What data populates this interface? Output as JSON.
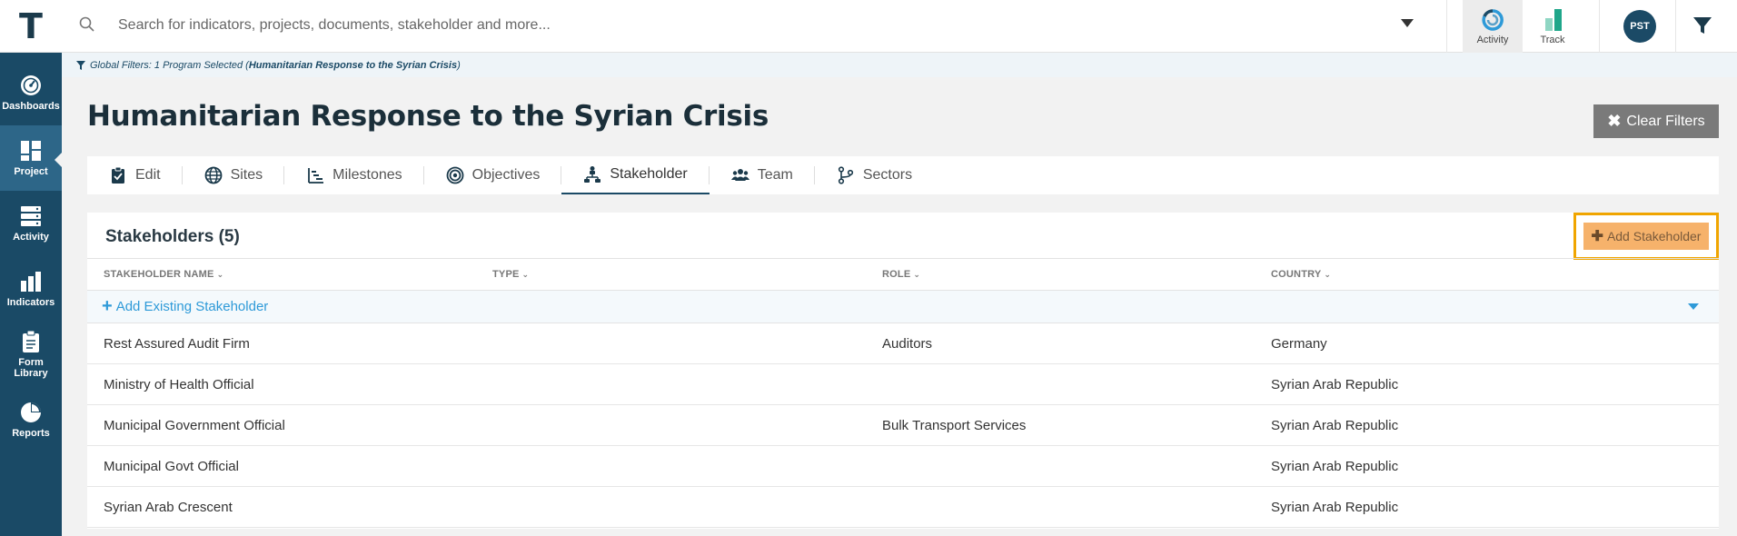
{
  "topbar": {
    "logo": "T",
    "search_placeholder": "Search for indicators, projects, documents, stakeholder and more...",
    "apps": [
      {
        "label": "Activity",
        "icon": "activity-app-icon",
        "active": true
      },
      {
        "label": "Track",
        "icon": "track-app-icon",
        "active": false
      }
    ],
    "avatar": "PST"
  },
  "sidebar": {
    "items": [
      {
        "label": "Dashboards",
        "icon": "dashboard-gauge-icon"
      },
      {
        "label": "Project",
        "icon": "project-grid-icon",
        "active": true
      },
      {
        "label": "Activity",
        "icon": "activity-list-icon"
      },
      {
        "label": "Indicators",
        "icon": "bar-chart-icon"
      },
      {
        "label_line1": "Form",
        "label_line2": "Library",
        "icon": "clipboard-icon"
      },
      {
        "label": "Reports",
        "icon": "pie-chart-icon"
      }
    ]
  },
  "global_filter": {
    "prefix": "Global Filters: 1 Program Selected ( ",
    "program": "Humanitarian Response to the Syrian Crisis",
    "suffix": " )"
  },
  "page": {
    "title": "Humanitarian Response to the Syrian Crisis",
    "clear_filters": "Clear Filters"
  },
  "tabs": [
    {
      "label": "Edit",
      "icon": "clipboard-check-icon"
    },
    {
      "label": "Sites",
      "icon": "globe-icon"
    },
    {
      "label": "Milestones",
      "icon": "milestones-icon"
    },
    {
      "label": "Objectives",
      "icon": "target-icon"
    },
    {
      "label": "Stakeholder",
      "icon": "org-chart-icon",
      "active": true
    },
    {
      "label": "Team",
      "icon": "team-icon"
    },
    {
      "label": "Sectors",
      "icon": "sectors-icon"
    }
  ],
  "stakeholders": {
    "title": "Stakeholders (5)",
    "add_button": "Add Stakeholder",
    "columns": [
      "STAKEHOLDER NAME",
      "TYPE",
      "ROLE",
      "COUNTRY"
    ],
    "add_existing": "Add Existing Stakeholder",
    "rows": [
      {
        "name": "Rest Assured Audit Firm",
        "type": "",
        "role": "Auditors",
        "country": "Germany"
      },
      {
        "name": "Ministry of Health Official",
        "type": "",
        "role": "",
        "country": "Syrian Arab Republic"
      },
      {
        "name": "Municipal Government Official",
        "type": "",
        "role": "Bulk Transport Services",
        "country": "Syrian Arab Republic"
      },
      {
        "name": "Municipal Govt Official",
        "type": "",
        "role": "",
        "country": "Syrian Arab Republic"
      },
      {
        "name": "Syrian Arab Crescent",
        "type": "",
        "role": "",
        "country": "Syrian Arab Republic"
      }
    ]
  },
  "colors": {
    "sidebar": "#1a4a66",
    "accent_orange": "#f6b26b",
    "highlight_border": "#f0a500",
    "link_blue": "#2e9ad8"
  }
}
